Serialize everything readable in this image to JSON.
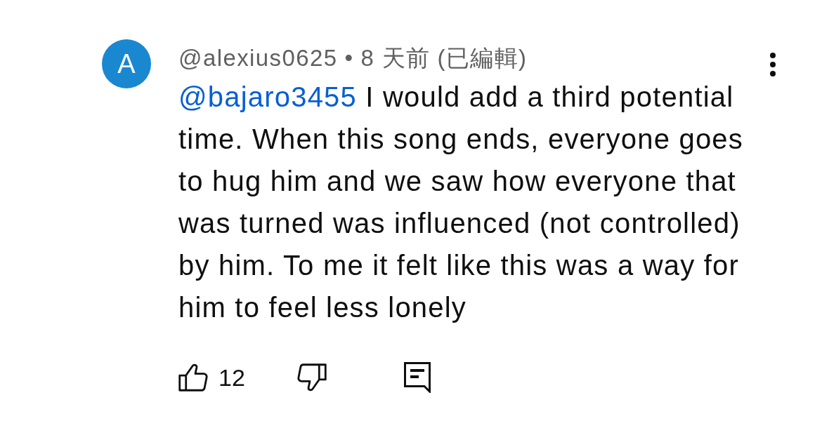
{
  "comment": {
    "avatar": {
      "letter": "A"
    },
    "author": "@alexius0625",
    "separator": "•",
    "time": "8 天前",
    "edited": "(已編輯)",
    "mention": "@bajaro3455",
    "text": "I would add a third potential time. When this song ends, everyone goes to hug him and we saw how everyone that was turned was influenced (not controlled) by him. To me it felt like this was a way for him to feel less lonely",
    "actions": {
      "like": {
        "count": "12",
        "pressed": false
      },
      "dislike": {
        "pressed": false
      }
    }
  }
}
